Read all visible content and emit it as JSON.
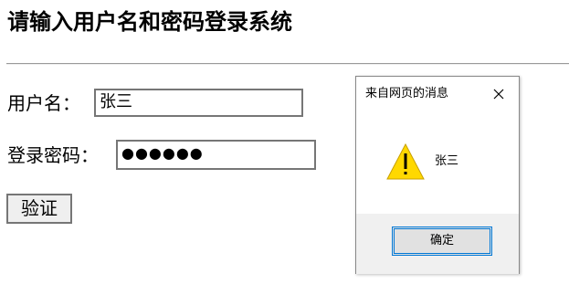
{
  "page": {
    "title": "请输入用户名和密码登录系统"
  },
  "form": {
    "username_label": "用户名：",
    "username_value": "张三",
    "password_label": "登录密码：",
    "password_value": "●●●●●●",
    "verify_button": "验证"
  },
  "dialog": {
    "title": "来自网页的消息",
    "close_icon": "close-icon",
    "warning_icon": "warning-icon",
    "message": "张三",
    "ok_button": "确定",
    "colors": {
      "warning_fill": "#FFD800",
      "footer_bg": "#F0F0F0",
      "focus_border": "#0078D7"
    }
  }
}
